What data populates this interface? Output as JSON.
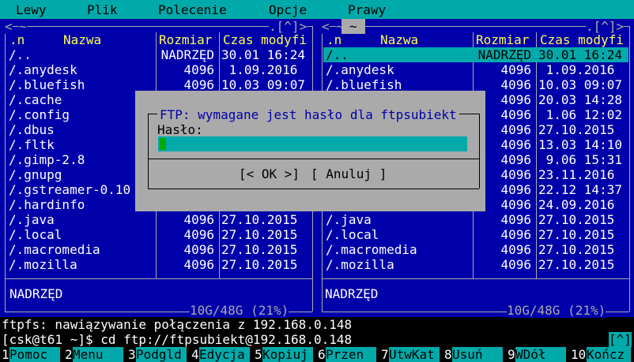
{
  "menu": [
    "Lewy",
    "Plik",
    "Polecenie",
    "Opcje",
    "Prawy"
  ],
  "panel_controls": {
    "history": "<",
    "arrow": "~",
    "right_ctrl": ".[^]>",
    "title_left": "~",
    "title_right": "~"
  },
  "columns": {
    "sort": ".n",
    "name": "Nazwa",
    "size": "Rozmiar",
    "mtime": "Czas modyfi",
    "mtime_right": "Czas modyfi"
  },
  "left_panel": {
    "rows": [
      {
        "name": "/..",
        "size": "NADRZĘD",
        "mtime": "30.01 16:24"
      },
      {
        "name": "/.anydesk",
        "size": "4096",
        "mtime": " 1.09.2016"
      },
      {
        "name": "/.bluefish",
        "size": "4096",
        "mtime": "10.03 09:07"
      },
      {
        "name": "/.cache",
        "size": "",
        "mtime": ""
      },
      {
        "name": "/.config",
        "size": "",
        "mtime": ""
      },
      {
        "name": "/.dbus",
        "size": "",
        "mtime": ""
      },
      {
        "name": "/.fltk",
        "size": "",
        "mtime": ""
      },
      {
        "name": "/.gimp-2.8",
        "size": "",
        "mtime": ""
      },
      {
        "name": "/.gnupg",
        "size": "",
        "mtime": ""
      },
      {
        "name": "/.gstreamer-0.10",
        "size": "",
        "mtime": ""
      },
      {
        "name": "/.hardinfo",
        "size": "",
        "mtime": ""
      },
      {
        "name": "/.java",
        "size": "4096",
        "mtime": "27.10.2015"
      },
      {
        "name": "/.local",
        "size": "4096",
        "mtime": "27.10.2015"
      },
      {
        "name": "/.macromedia",
        "size": "4096",
        "mtime": "27.10.2015"
      },
      {
        "name": "/.mozilla",
        "size": "4096",
        "mtime": "27.10.2015"
      }
    ],
    "status": "NADRZĘD",
    "disk": "10G/48G (21%)"
  },
  "right_panel": {
    "rows": [
      {
        "name": "/..",
        "size": "NADRZĘD",
        "mtime": "30.01 16:24",
        "selected": true
      },
      {
        "name": "/.anydesk",
        "size": "4096",
        "mtime": " 1.09.2016"
      },
      {
        "name": "/.bluefish",
        "size": "4096",
        "mtime": "10.03 09:07"
      },
      {
        "name": "",
        "size": "4096",
        "mtime": "20.03 14:28"
      },
      {
        "name": "",
        "size": "4096",
        "mtime": " 1.06 12:02"
      },
      {
        "name": "",
        "size": "4096",
        "mtime": "27.10.2015"
      },
      {
        "name": "",
        "size": "4096",
        "mtime": "13.03 14:10"
      },
      {
        "name": "",
        "size": "4096",
        "mtime": " 9.06 15:31"
      },
      {
        "name": "",
        "size": "4096",
        "mtime": "23.11.2016"
      },
      {
        "name": "",
        "size": "4096",
        "mtime": "22.12 14:37"
      },
      {
        "name": "",
        "size": "4096",
        "mtime": "24.09.2016"
      },
      {
        "name": "/.java",
        "size": "4096",
        "mtime": "27.10.2015"
      },
      {
        "name": "/.local",
        "size": "4096",
        "mtime": "27.10.2015"
      },
      {
        "name": "/.macromedia",
        "size": "4096",
        "mtime": "27.10.2015"
      },
      {
        "name": "/.mozilla",
        "size": "4096",
        "mtime": "27.10.2015"
      }
    ],
    "status": "NADRZĘD",
    "disk": "10G/48G (21%)"
  },
  "dialog": {
    "title": "FTP: wymagane jest hasło dla ftpsubiekt",
    "label": "Hasło:",
    "value": "",
    "ok": "[< OK >]",
    "cancel": "[ Anuluj ]"
  },
  "console": {
    "line1": "ftpfs: nawiązywanie połączenia z 192.168.0.148",
    "prompt": "[csk@t61 ~]$ cd ftp://ftpsubiekt@192.168.0.148",
    "scroll": "[^]"
  },
  "fkeys": [
    {
      "num": "1",
      "label": "Pomoc"
    },
    {
      "num": "2",
      "label": "Menu"
    },
    {
      "num": "3",
      "label": "Podgld"
    },
    {
      "num": "4",
      "label": "Edycja"
    },
    {
      "num": "5",
      "label": "Kopiuj"
    },
    {
      "num": "6",
      "label": "Przen"
    },
    {
      "num": "7",
      "label": "UtwKat"
    },
    {
      "num": "8",
      "label": "Usuń"
    },
    {
      "num": "9",
      "label": "WDół"
    },
    {
      "num": "10",
      "label": "Kończ"
    }
  ],
  "colors": {
    "panel_bg": "#0000aa",
    "accent": "#00aaaa",
    "header": "#ffff55",
    "dialog_bg": "#aaaaaa",
    "input": "#00aaaa",
    "cursor": "#00aa00"
  }
}
